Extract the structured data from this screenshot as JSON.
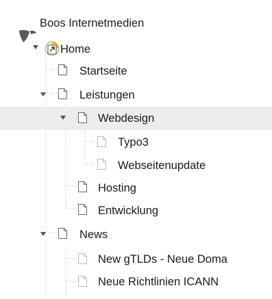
{
  "tree": {
    "root": {
      "label": "Boos Internetmedien",
      "icon": "typo3-logo-icon"
    },
    "home": {
      "label": "Home",
      "icon": "home-page-icon"
    },
    "pages": [
      {
        "label": "Startseite",
        "icon": "page-icon"
      },
      {
        "label": "Leistungen",
        "icon": "page-icon",
        "expanded": true
      },
      {
        "label": "Webdesign",
        "icon": "page-icon",
        "expanded": true,
        "selected": true
      },
      {
        "label": "Typo3",
        "icon": "page-hidden-icon"
      },
      {
        "label": "Webseitenupdate",
        "icon": "page-hidden-icon"
      },
      {
        "label": "Hosting",
        "icon": "page-icon"
      },
      {
        "label": "Entwicklung",
        "icon": "page-icon"
      },
      {
        "label": "News",
        "icon": "page-icon",
        "expanded": true
      },
      {
        "label": "New gTLDs - Neue Doma",
        "icon": "page-hidden-icon"
      },
      {
        "label": "Neue Richtlinien ICANN",
        "icon": "page-hidden-icon"
      }
    ]
  },
  "colors": {
    "selected_row": "#ededed",
    "guide_line": "#b5b5b5",
    "logo": "#5a5a5a",
    "home_icon": "#3a7fc1"
  }
}
